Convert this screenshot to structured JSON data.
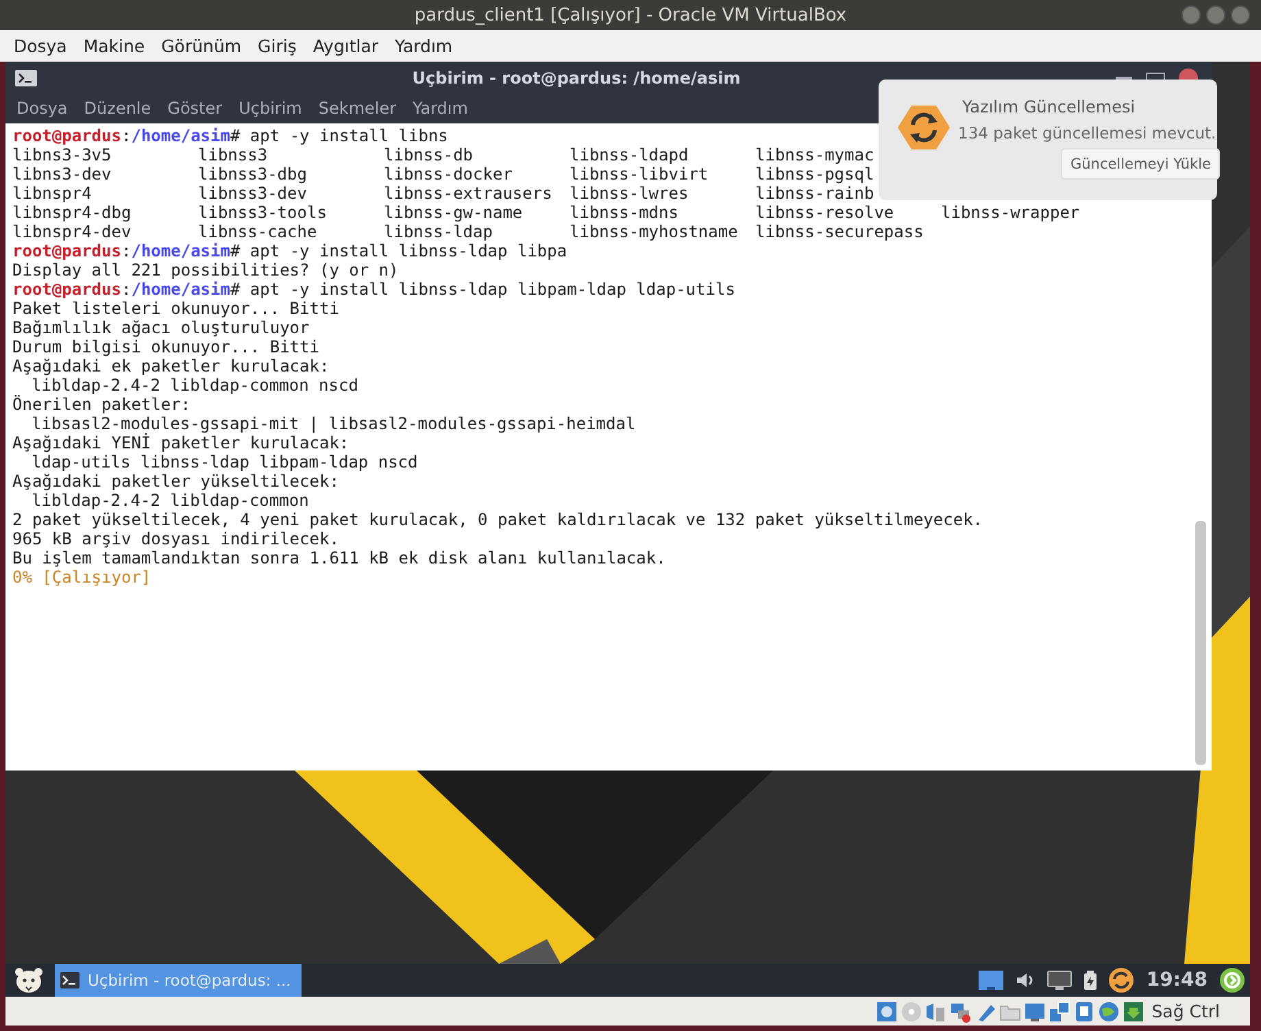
{
  "host_window": {
    "title": "pardus_client1 [Çalışıyor] - Oracle VM VirtualBox",
    "menu": [
      "Dosya",
      "Makine",
      "Görünüm",
      "Giriş",
      "Aygıtlar",
      "Yardım"
    ]
  },
  "terminal": {
    "title": "Uçbirim - root@pardus: /home/asim",
    "menu": [
      "Dosya",
      "Düzenle",
      "Göster",
      "Uçbirim",
      "Sekmeler",
      "Yardım"
    ],
    "lines": [
      {
        "kind": "prompt",
        "user": "root@pardus",
        "separator": ":",
        "path": "/home/asim",
        "command": "# apt -y install libns"
      },
      {
        "kind": "columns",
        "cells": [
          "libns3-3v5",
          "libnss3",
          "libnss-db",
          "libnss-ldapd",
          "libnss-mymac"
        ]
      },
      {
        "kind": "columns",
        "cells": [
          "libns3-dev",
          "libnss3-dbg",
          "libnss-docker",
          "libnss-libvirt",
          "libnss-pgsql"
        ]
      },
      {
        "kind": "columns",
        "cells": [
          "libnspr4",
          "libnss3-dev",
          "libnss-extrausers",
          "libnss-lwres",
          "libnss-rainb"
        ]
      },
      {
        "kind": "columns",
        "cells": [
          "libnspr4-dbg",
          "libnss3-tools",
          "libnss-gw-name",
          "libnss-mdns",
          "libnss-resolve",
          "libnss-wrapper"
        ]
      },
      {
        "kind": "columns",
        "cells": [
          "libnspr4-dev",
          "libnss-cache",
          "libnss-ldap",
          "libnss-myhostname",
          "libnss-securepass"
        ]
      },
      {
        "kind": "prompt",
        "user": "root@pardus",
        "separator": ":",
        "path": "/home/asim",
        "command": "# apt -y install libnss-ldap libpa"
      },
      {
        "kind": "output",
        "text": "Display all 221 possibilities? (y or n)"
      },
      {
        "kind": "prompt",
        "user": "root@pardus",
        "separator": ":",
        "path": "/home/asim",
        "command": "# apt -y install libnss-ldap libpam-ldap ldap-utils"
      },
      {
        "kind": "output",
        "text": "Paket listeleri okunuyor... Bitti"
      },
      {
        "kind": "output",
        "text": "Bağımlılık ağacı oluşturuluyor"
      },
      {
        "kind": "output",
        "text": "Durum bilgisi okunuyor... Bitti"
      },
      {
        "kind": "output",
        "text": "Aşağıdaki ek paketler kurulacak:"
      },
      {
        "kind": "indented",
        "text": "libldap-2.4-2 libldap-common nscd"
      },
      {
        "kind": "output",
        "text": "Önerilen paketler:"
      },
      {
        "kind": "indented",
        "text": "libsasl2-modules-gssapi-mit | libsasl2-modules-gssapi-heimdal"
      },
      {
        "kind": "output",
        "text": "Aşağıdaki YENİ paketler kurulacak:"
      },
      {
        "kind": "indented",
        "text": "ldap-utils libnss-ldap libpam-ldap nscd"
      },
      {
        "kind": "output",
        "text": "Aşağıdaki paketler yükseltilecek:"
      },
      {
        "kind": "indented",
        "text": "libldap-2.4-2 libldap-common"
      },
      {
        "kind": "output",
        "text": "2 paket yükseltilecek, 4 yeni paket kurulacak, 0 paket kaldırılacak ve 132 paket yükseltilmeyecek."
      },
      {
        "kind": "output",
        "text": "965 kB arşiv dosyası indirilecek."
      },
      {
        "kind": "output",
        "text": "Bu işlem tamamlandıktan sonra 1.611 kB ek disk alanı kullanılacak."
      },
      {
        "kind": "progress",
        "text": "0% [Çalışıyor]"
      }
    ]
  },
  "notification": {
    "title": "Yazılım Güncellemesi",
    "message": "134 paket güncellemesi mevcut.",
    "button": "Güncellemeyi Yükle"
  },
  "taskbar": {
    "tasks": [
      {
        "label": "Uçbirim - root@pardus: ...",
        "selected": true
      }
    ],
    "clock": "19:48"
  },
  "status_bar": {
    "host_key": "Sağ Ctrl"
  }
}
